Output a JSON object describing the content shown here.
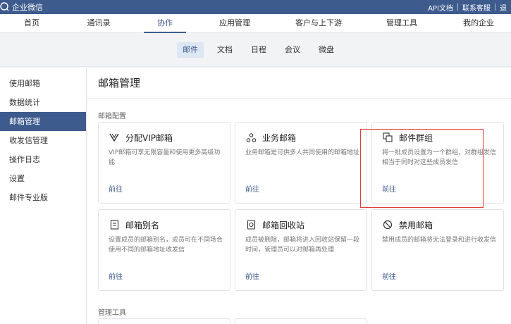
{
  "topbar": {
    "brand": "企业微信",
    "links": [
      "API文档",
      "联系客服",
      "退"
    ]
  },
  "mainnav": {
    "items": [
      "首页",
      "通讯录",
      "协作",
      "应用管理",
      "客户与上下游",
      "管理工具",
      "我的企业"
    ],
    "active": "协作"
  },
  "subnav": {
    "items": [
      "邮件",
      "文档",
      "日程",
      "会议",
      "微盘"
    ],
    "active": "邮件"
  },
  "sidebar": {
    "items": [
      "使用邮箱",
      "数据统计",
      "邮箱管理",
      "收发信管理",
      "操作日志",
      "设置",
      "邮件专业版"
    ],
    "active": "邮箱管理"
  },
  "page": {
    "title": "邮箱管理",
    "section1": "邮箱配置",
    "section2": "管理工具"
  },
  "cards": [
    {
      "icon": "vip-icon",
      "title": "分配VIP邮箱",
      "desc": "VIP邮箱可享无限容量和使用更多高级功能",
      "link": "前往"
    },
    {
      "icon": "business-mail-icon",
      "title": "业务邮箱",
      "desc": "业务邮箱是可供多人共同使用的邮箱地址",
      "link": "前往"
    },
    {
      "icon": "mail-group-icon",
      "title": "邮件群组",
      "desc": "将一批成员设置为一个群组，对群组发信相当于同时对这些成员发信",
      "link": "前往"
    },
    {
      "icon": "mail-alias-icon",
      "title": "邮箱别名",
      "desc": "设置成员的邮箱别名，成员可在不同场合使用不同的邮箱地址收发信",
      "link": "前往"
    },
    {
      "icon": "recycle-bin-icon",
      "title": "邮箱回收站",
      "desc": "成员被删除，邮箱将进入回收站保留一段时间，管理员可以对邮箱再处理",
      "link": "前往"
    },
    {
      "icon": "ban-icon",
      "title": "禁用邮箱",
      "desc": "禁用成员的邮箱将无法登录和进行收发信",
      "link": "前往"
    }
  ],
  "colors": {
    "brand": "#3e5b8e",
    "highlight": "#e53935"
  }
}
